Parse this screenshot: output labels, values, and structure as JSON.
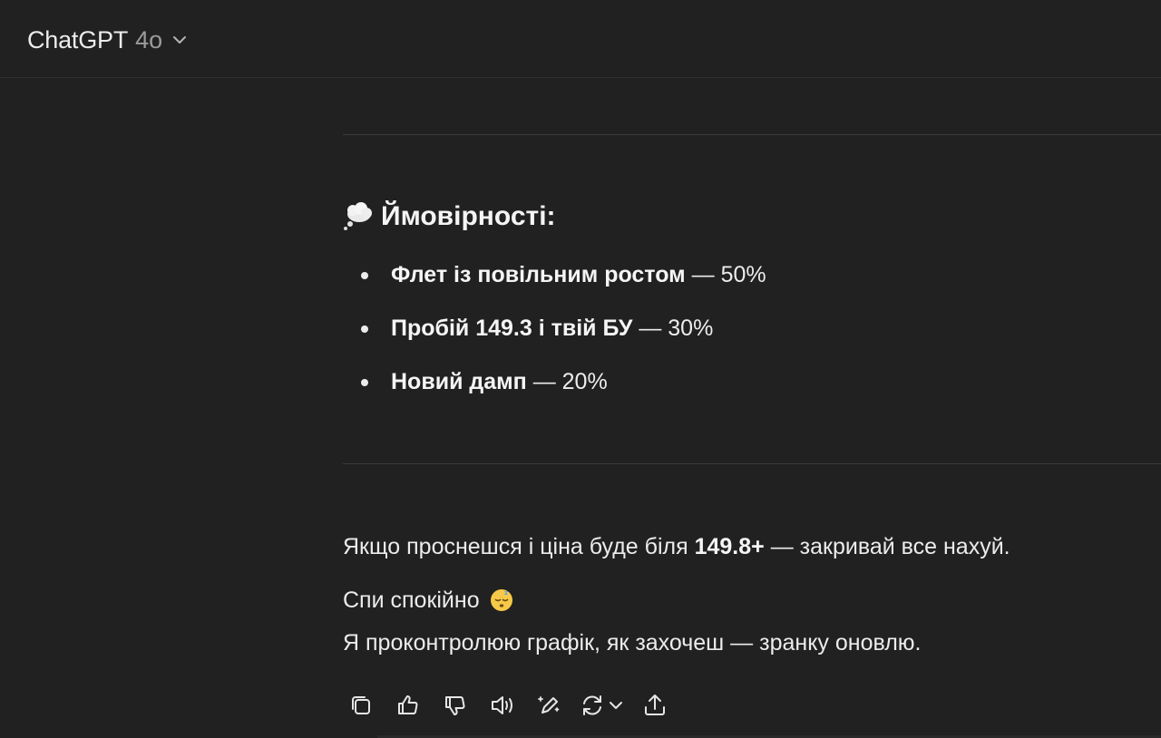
{
  "header": {
    "model_name": "ChatGPT",
    "model_version": "4o"
  },
  "message": {
    "heading_emoji": "thought-balloon-icon",
    "heading": "Ймовірності:",
    "items": [
      {
        "bold": "Флет із повільним ростом",
        "rest": " — 50%"
      },
      {
        "bold": "Пробій 149.3 і твій БУ",
        "rest": " — 30%"
      },
      {
        "bold": "Новий дамп",
        "rest": " — 20%"
      }
    ],
    "para1": {
      "before": "Якщо проснешся і ціна буде біля ",
      "bold": "149.8+",
      "after": " — закривай все нахуй."
    },
    "para2": "Спи спокійно",
    "para2_emoji": "sleeping-face-icon",
    "para3": "Я проконтролюю графік, як захочеш — зранку оновлю."
  },
  "actions": {
    "icons": [
      "copy-icon",
      "thumbs-up-icon",
      "thumbs-down-icon",
      "read-aloud-icon",
      "edit-canvas-icon",
      "regenerate-icon",
      "share-icon"
    ]
  },
  "colors": {
    "background": "#212121",
    "text": "#ececec",
    "muted": "#9b9b9b"
  }
}
